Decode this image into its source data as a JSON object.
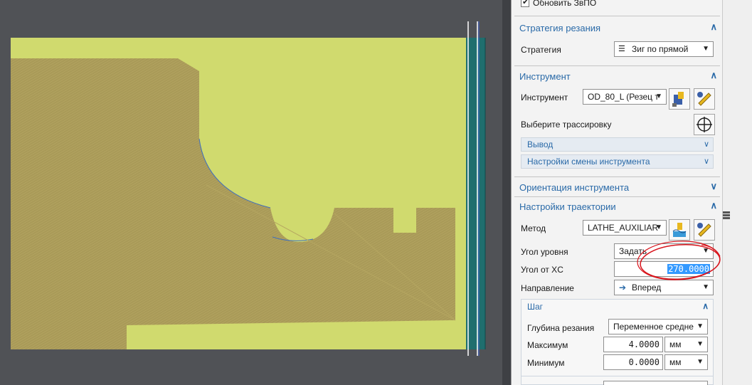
{
  "panel": {
    "update_ipw": {
      "label": "Обновить ЗвПО",
      "checked": true
    },
    "cut_strategy": {
      "title": "Стратегия резания",
      "strategy_label": "Стратегия",
      "strategy_value": "Зиг по прямой"
    },
    "tool": {
      "title": "Инструмент",
      "tool_label": "Инструмент",
      "tool_value": "OD_80_L (Резец т",
      "select_tracking_label": "Выберите трассировку",
      "output_title": "Вывод",
      "tool_change_title": "Настройки смены инструмента"
    },
    "tool_orientation": {
      "title": "Ориентация инструмента"
    },
    "path_settings": {
      "title": "Настройки траектории",
      "method_label": "Метод",
      "method_value": "LATHE_AUXILIAR",
      "level_angle_label": "Угол уровня",
      "level_angle_value": "Задать",
      "angle_xc_label": "Угол от XC",
      "angle_xc_value": "270.0000",
      "direction_label": "Направление",
      "direction_value": "Вперед",
      "step": {
        "title": "Шаг",
        "depth_label": "Глубина резания",
        "depth_value": "Переменное средне",
        "max_label": "Максимум",
        "max_value": "4.0000",
        "max_unit": "мм",
        "min_label": "Минимум",
        "min_value": "0.0000",
        "min_unit": "мм"
      }
    }
  },
  "colors": {
    "viewport_bg": "#505256",
    "stock": "#d0da6e",
    "part": "#a99a58",
    "tool_holder": "#1f6e6e",
    "accent": "#2a6aa8",
    "annotation": "#d8141c",
    "selection": "#3399ff"
  }
}
